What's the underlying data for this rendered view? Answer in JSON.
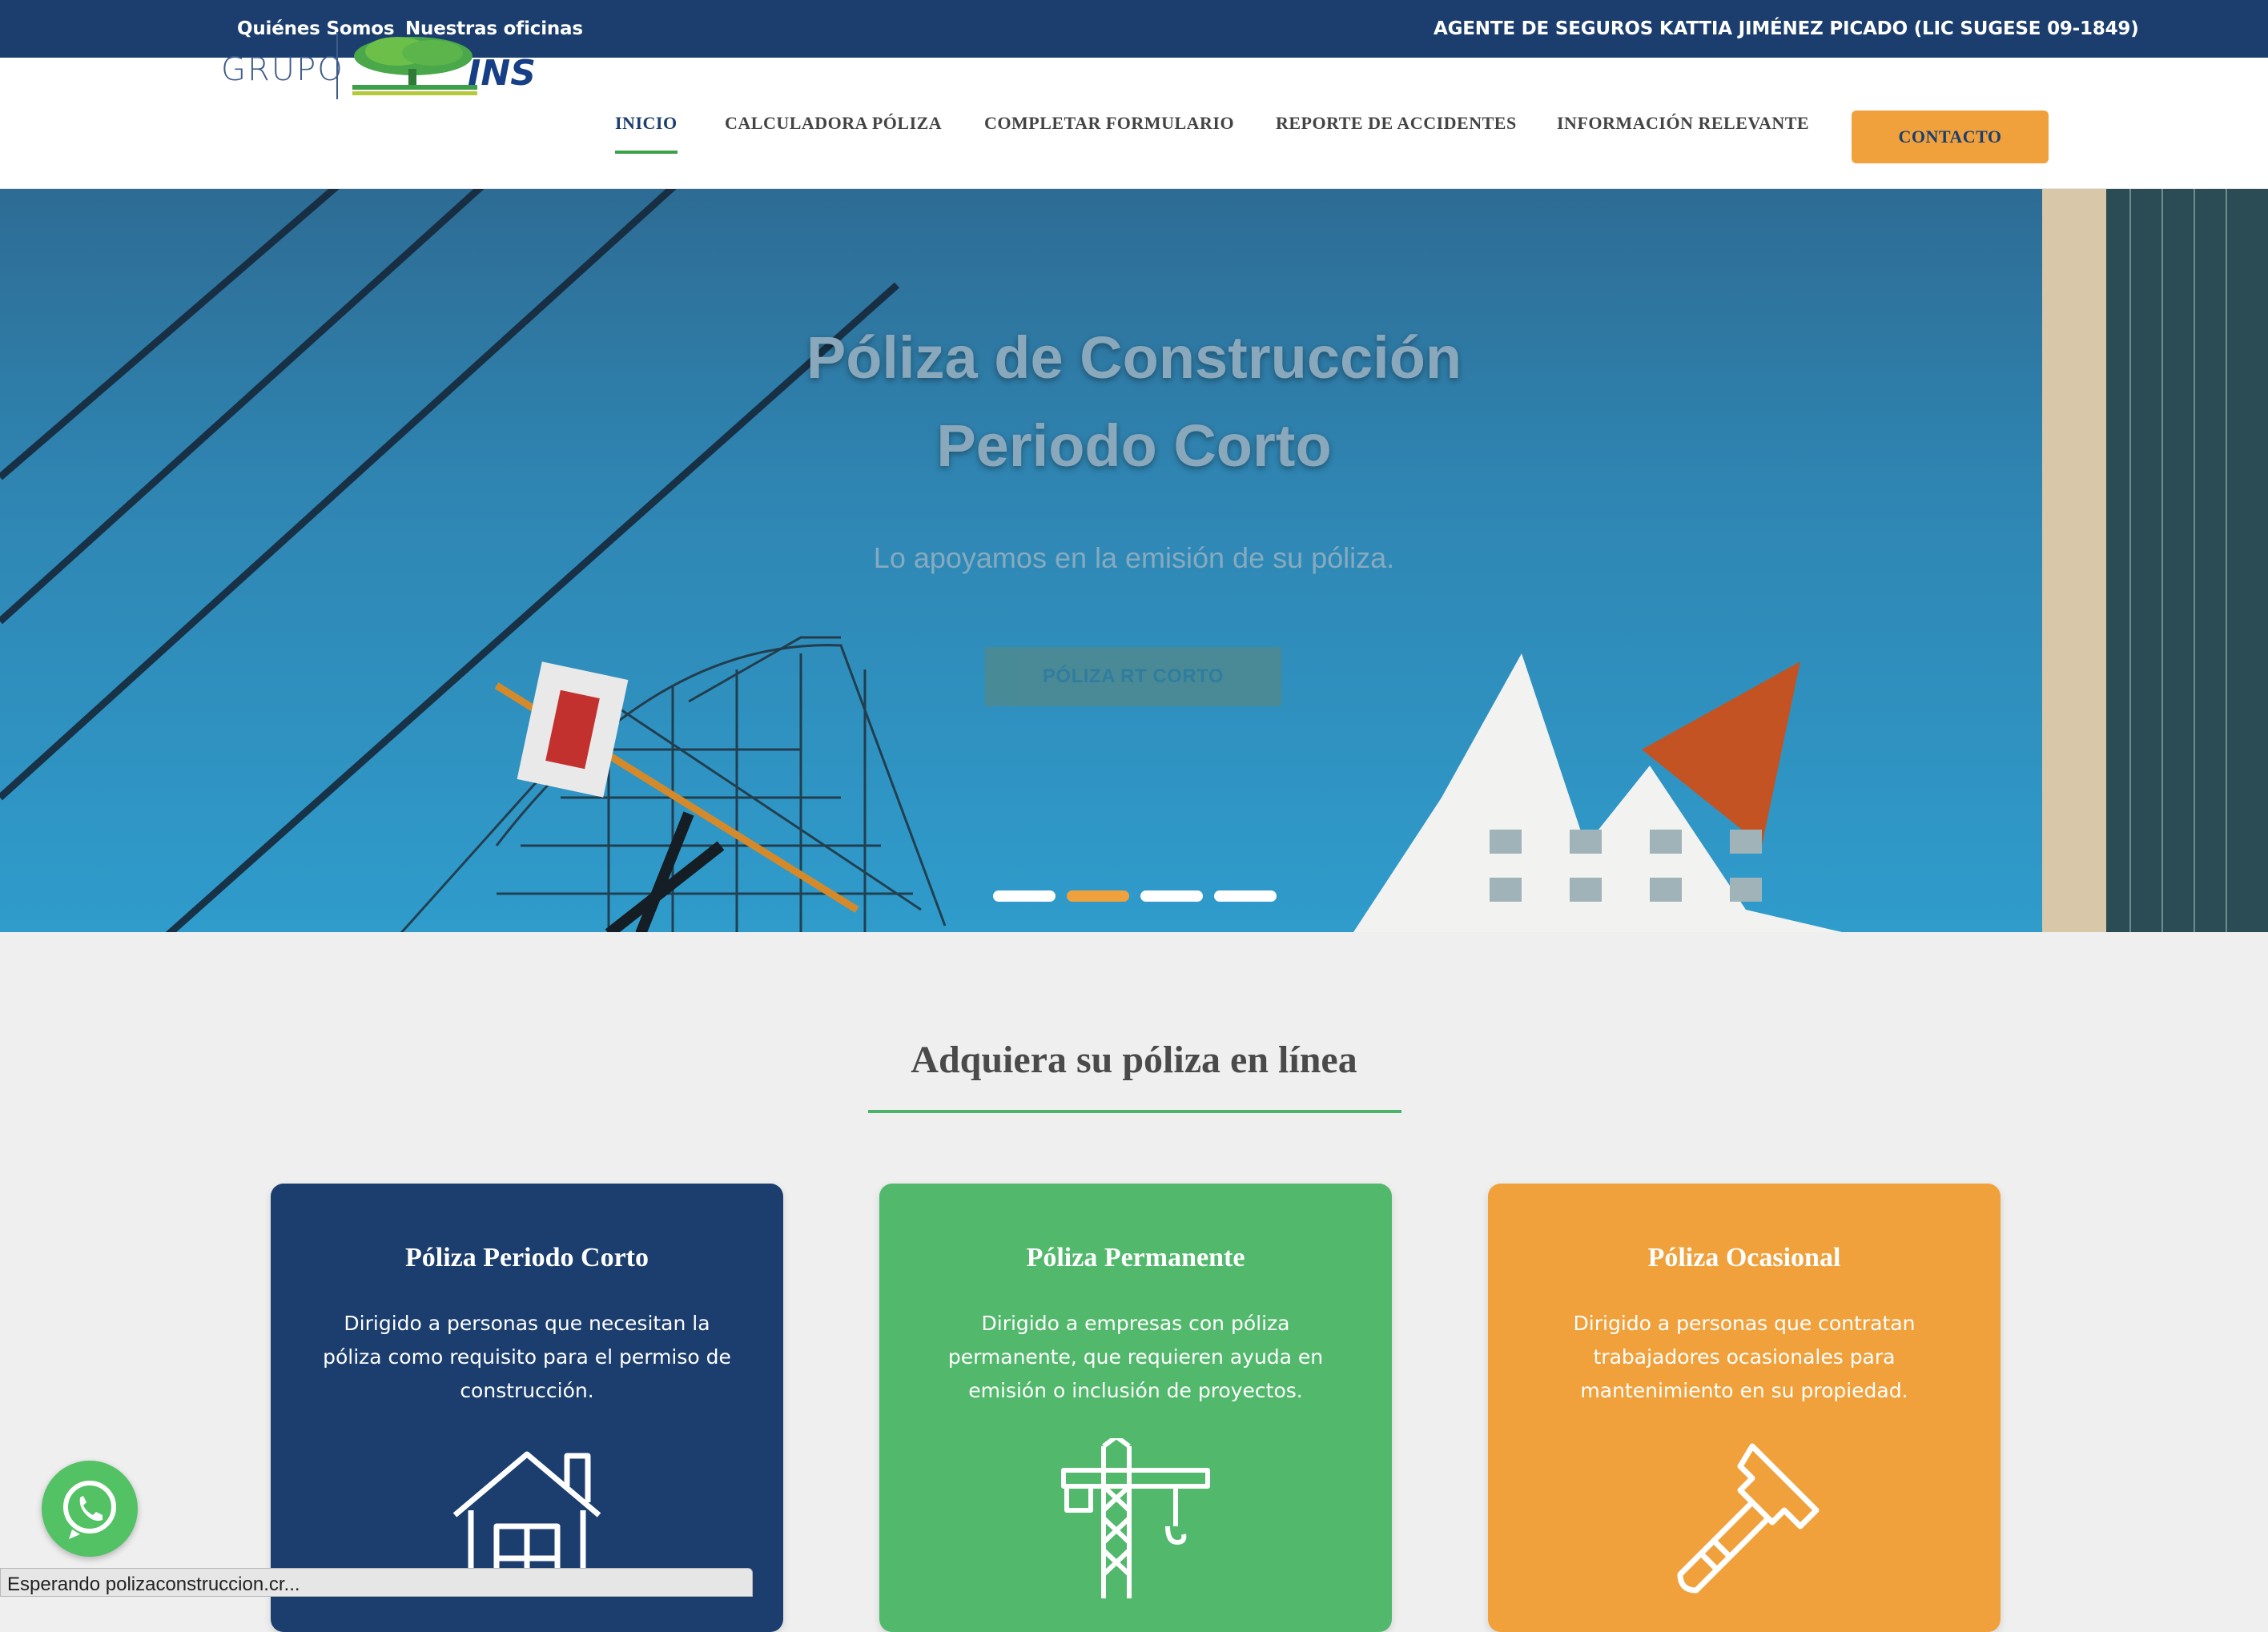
{
  "topbar": {
    "links": [
      "Quiénes Somos",
      "Nuestras oficinas"
    ],
    "agent": "AGENTE DE SEGUROS KATTIA JIMÉNEZ PICADO (LIC SUGESE 09-1849)"
  },
  "logo": {
    "word": "GRUPO",
    "brand": "INS"
  },
  "nav": {
    "items": [
      "INICIO",
      "CALCULADORA PÓLIZA",
      "COMPLETAR FORMULARIO",
      "REPORTE DE ACCIDENTES",
      "INFORMACIÓN RELEVANTE"
    ],
    "active": "INICIO",
    "contact": "CONTACTO",
    "accent_color": "#f0a13c",
    "active_underline_color": "#3c9f4a"
  },
  "hero": {
    "title_line1": "Póliza de Construcción",
    "title_line2": "Periodo Corto",
    "subtitle": "Lo apoyamos en la emisión de su póliza.",
    "button": "PÓLIZA RT CORTO",
    "slides_total": 4,
    "slide_active": 2
  },
  "section": {
    "title": "Adquiera su póliza en línea"
  },
  "cards": [
    {
      "title": "Póliza Periodo Corto",
      "text": "Dirigido a personas que necesitan la póliza como requisito para el permiso de construcción.",
      "icon": "house-icon",
      "color": "#1b3e6f"
    },
    {
      "title": "Póliza Permanente",
      "text": "Dirigido a empresas con póliza permanente, que requieren ayuda en emisión o inclusión de proyectos.",
      "icon": "crane-icon",
      "color": "#52b96c"
    },
    {
      "title": "Póliza Ocasional",
      "text": "Dirigido a personas que contratan trabajadores ocasionales para mantenimiento en su propiedad.",
      "icon": "hammer-icon",
      "color": "#f0a13c"
    }
  ],
  "whatsapp": {
    "icon": "whatsapp-icon",
    "color": "#52c264"
  },
  "status_bar": "Esperando polizaconstruccion.cr..."
}
